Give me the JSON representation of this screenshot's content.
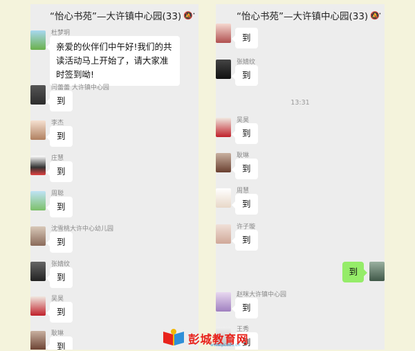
{
  "left_chat": {
    "title": "“怡心书苑”—大许镇中心园(33)",
    "messages": [
      {
        "sender": "杜梦玥",
        "text": "亲爱的伙伴们中午好!我们的共读活动马上开始了，请大家准时签到呦!"
      },
      {
        "sender": "闫蕾蕾  大许镇中心园",
        "text": "到"
      },
      {
        "sender": "李杰",
        "text": "到"
      },
      {
        "sender": "庄慧",
        "text": "到"
      },
      {
        "sender": "周聪",
        "text": "到"
      },
      {
        "sender": "沈雪桃大许中心幼儿园",
        "text": "到"
      },
      {
        "sender": "张婧纹",
        "text": "到"
      },
      {
        "sender": "吴昊",
        "text": "到"
      },
      {
        "sender": "耿琳",
        "text": "到"
      }
    ]
  },
  "right_chat": {
    "title": "“怡心书苑”—大许镇中心园(33)",
    "timestamp": "13:31",
    "messages": [
      {
        "sender": "",
        "text": "到"
      },
      {
        "sender": "张婧纹",
        "text": "到"
      },
      {
        "sender": "吴昊",
        "text": "到"
      },
      {
        "sender": "耿琳",
        "text": "到"
      },
      {
        "sender": "周慧",
        "text": "到"
      },
      {
        "sender": "许子璇",
        "text": "到"
      },
      {
        "sender": "赵咪大许镇中心园",
        "text": "到"
      },
      {
        "sender": "王秀",
        "text": "到"
      }
    ],
    "my_message": "到"
  },
  "watermark": {
    "text": "彭城教育网",
    "sub": "www.pcedu.cn"
  }
}
